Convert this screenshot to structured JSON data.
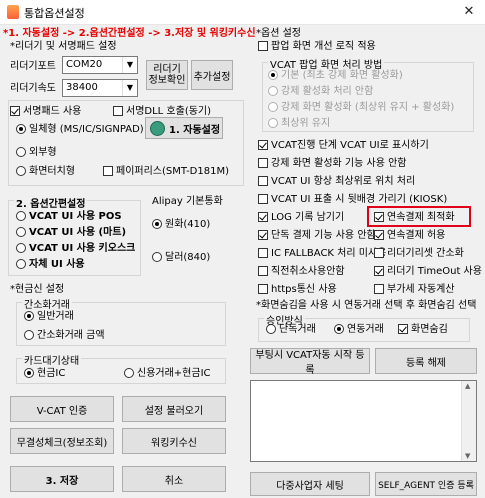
{
  "window": {
    "title": "통합옵션설정",
    "close": "✕"
  },
  "steps": "*1. 자동설정 -> 2.옵션간편설정 -> 3.저장 및 워킹키수신",
  "reader": {
    "section_label": "*리더기 및 서명패드 설정",
    "port_label": "리더기포트",
    "port_value": "COM20",
    "speed_label": "리더기속도",
    "speed_value": "38400",
    "info_button": "리더기\n정보확인",
    "add_button": "추가설정",
    "sign_use": "서명패드 사용",
    "sign_dll": "서명DLL 호출(동기)",
    "auto_button": "1. 자동설정",
    "sign_options": [
      "일체형 (MS/IC/SIGNPAD)",
      "외부형",
      "화면터치형"
    ],
    "paperless": "페이퍼리스(SMT-D181M)"
  },
  "simple": {
    "label": "2. 옵션간편설정",
    "options": [
      "VCAT UI 사용 POS",
      "VCAT UI 사용 (마트)",
      "VCAT UI 사용 키오스크",
      "자체 UI 사용"
    ]
  },
  "alipay": {
    "label": "Alipay 기본통화",
    "options": [
      "원화(410)",
      "달러(840)"
    ]
  },
  "cash": {
    "label": "*현금신 설정",
    "simple_label": "간소화거래",
    "simple_options": [
      "일반거래",
      "간소화거래 금액"
    ],
    "card_label": "카드대기상태",
    "card_options": [
      "현금IC",
      "신용거래+현금IC"
    ]
  },
  "buttons_left": {
    "vcat_auth": "V-CAT 인증",
    "load_settings": "설정 불러오기",
    "integrity": "무결성체크(정보조회)",
    "working_key": "워킹키수신",
    "save": "3. 저장",
    "cancel": "취소"
  },
  "options": {
    "label": "*옵션 설정",
    "popup_logic": "팝업 화면 개선 로직 적용",
    "vcat_popup_label": "VCAT 팝업 화면 처리 방법",
    "popup_methods": [
      "기본 (최초 강제 화면 활성화)",
      "강제 활성화 처리 안함",
      "강제 화면 활성화 (최상위 유지 + 활성화)",
      "최상위 유지"
    ],
    "checks": [
      {
        "label": "VCAT진행 단계 VCAT UI로 표시하기",
        "checked": true
      },
      {
        "label": "강제 화면 활성화 기능 사용 안함",
        "checked": false
      },
      {
        "label": "VCAT UI 항상 최상위로 위치 처리",
        "checked": false
      },
      {
        "label": "VCAT UI 표출 시 뒷배경 가리기 (KIOSK)",
        "checked": false
      }
    ],
    "grid": [
      [
        {
          "label": "LOG 기록 남기기",
          "checked": true
        },
        {
          "label": "연속결제 최적화",
          "checked": true
        }
      ],
      [
        {
          "label": "단독 결제 기능 사용 안함",
          "checked": true
        },
        {
          "label": "연속결제 허용",
          "checked": true
        }
      ],
      [
        {
          "label": "IC FALLBACK 처리 미사용",
          "checked": false
        },
        {
          "label": "리더기리셋 간소화",
          "checked": false
        }
      ],
      [
        {
          "label": "직전취소사용안함",
          "checked": false
        },
        {
          "label": "리더기 TimeOut 사용",
          "checked": true
        }
      ],
      [
        {
          "label": "https통신 사용",
          "checked": false
        },
        {
          "label": "부가세 자동계산",
          "checked": false
        }
      ]
    ],
    "screensaver_label": "*화면숨김을 사용 시 연동거래 선택 후 화면숨김 선택",
    "approval_label": "승인방식",
    "approval_options": [
      "단독거래",
      "연동거래"
    ],
    "hide_screen": "화면숨김",
    "boot_register": "부팅시 VCAT자동 시작 등록",
    "register_cancel": "등록 해제",
    "multi_biz": "다중사업자 세팅",
    "self_agent": "SELF_AGENT 인증 등록"
  }
}
